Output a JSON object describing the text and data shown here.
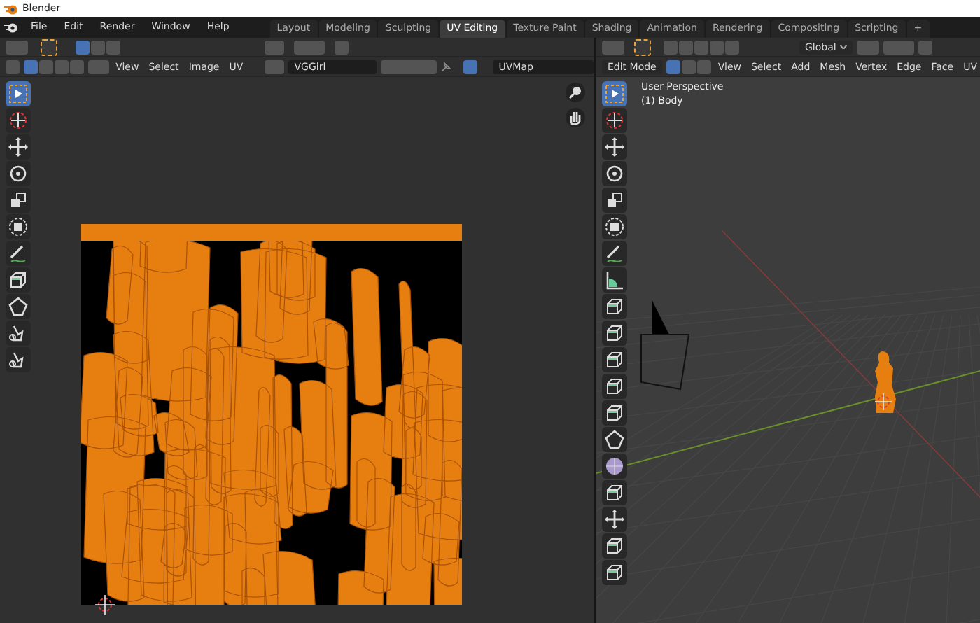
{
  "window": {
    "title": "Blender"
  },
  "menu": [
    "File",
    "Edit",
    "Render",
    "Window",
    "Help"
  ],
  "workspace_tabs": [
    {
      "label": "Layout",
      "selected": false
    },
    {
      "label": "Modeling",
      "selected": false
    },
    {
      "label": "Sculpting",
      "selected": false
    },
    {
      "label": "UV Editing",
      "selected": true
    },
    {
      "label": "Texture Paint",
      "selected": false
    },
    {
      "label": "Shading",
      "selected": false
    },
    {
      "label": "Animation",
      "selected": false
    },
    {
      "label": "Rendering",
      "selected": false
    },
    {
      "label": "Compositing",
      "selected": false
    },
    {
      "label": "Scripting",
      "selected": false
    },
    {
      "label": "+",
      "selected": false
    }
  ],
  "uv_editor": {
    "menus": [
      "View",
      "Select",
      "Image",
      "UV"
    ],
    "image_name": "VGGirl",
    "uv_map": "UVMap",
    "select_modes": [
      {
        "selected": true
      },
      {
        "selected": false
      },
      {
        "selected": false
      },
      {
        "selected": false
      }
    ],
    "tools": [
      {
        "kind": "select",
        "selected": true
      },
      {
        "kind": "cursor",
        "selected": false
      },
      {
        "kind": "move",
        "selected": false
      },
      {
        "kind": "rotate",
        "selected": false
      },
      {
        "kind": "scale",
        "selected": false
      },
      {
        "kind": "transform",
        "selected": false
      },
      {
        "kind": "annotate",
        "selected": false
      },
      {
        "kind": "cube",
        "selected": false
      },
      {
        "kind": "polygon",
        "selected": false
      },
      {
        "kind": "grab",
        "selected": false
      },
      {
        "kind": "grab",
        "selected": false
      }
    ]
  },
  "viewport": {
    "orientation": "Global",
    "mode": "Edit Mode",
    "menus": [
      "View",
      "Select",
      "Add",
      "Mesh",
      "Vertex",
      "Edge",
      "Face",
      "UV"
    ],
    "select_modes": [
      {
        "selected": true
      },
      {
        "selected": false
      },
      {
        "selected": false
      }
    ],
    "view_name": "User Perspective",
    "object_label": "(1) Body",
    "tools": [
      {
        "kind": "select",
        "selected": true
      },
      {
        "kind": "cursor",
        "selected": false
      },
      {
        "kind": "move",
        "selected": false
      },
      {
        "kind": "rotate",
        "selected": false
      },
      {
        "kind": "scale",
        "selected": false
      },
      {
        "kind": "transform",
        "selected": false
      },
      {
        "kind": "annotate",
        "selected": false
      },
      {
        "kind": "measure",
        "selected": false
      },
      {
        "kind": "cube",
        "selected": false
      },
      {
        "kind": "cube",
        "selected": false
      },
      {
        "kind": "cube",
        "selected": false
      },
      {
        "kind": "cube",
        "selected": false
      },
      {
        "kind": "cube",
        "selected": false
      },
      {
        "kind": "polygon",
        "selected": false
      },
      {
        "kind": "sphere",
        "selected": false
      },
      {
        "kind": "cube",
        "selected": false
      },
      {
        "kind": "move",
        "selected": false
      },
      {
        "kind": "cube",
        "selected": false
      },
      {
        "kind": "cube",
        "selected": false
      }
    ]
  }
}
